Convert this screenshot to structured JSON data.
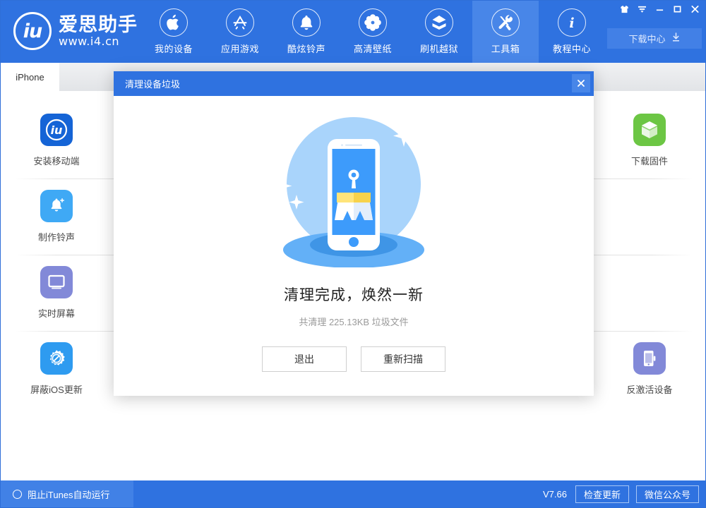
{
  "brand": {
    "logo_mark": "iu",
    "name_cn": "爱思助手",
    "url": "www.i4.cn"
  },
  "header": {
    "nav": [
      {
        "label": "我的设备",
        "icon": "apple-icon",
        "active": false
      },
      {
        "label": "应用游戏",
        "icon": "appstore-icon",
        "active": false
      },
      {
        "label": "酷炫铃声",
        "icon": "bell-icon",
        "active": false
      },
      {
        "label": "高清壁纸",
        "icon": "flower-icon",
        "active": false
      },
      {
        "label": "刷机越狱",
        "icon": "box-icon",
        "active": false
      },
      {
        "label": "工具箱",
        "icon": "tools-icon",
        "active": true
      },
      {
        "label": "教程中心",
        "icon": "info-icon",
        "active": false
      }
    ],
    "window_controls": [
      {
        "name": "skin-icon",
        "glyph": "shirt"
      },
      {
        "name": "menu-icon",
        "glyph": "caret"
      },
      {
        "name": "minimize-icon",
        "glyph": "minimize"
      },
      {
        "name": "maximize-icon",
        "glyph": "maximize"
      },
      {
        "name": "close-icon",
        "glyph": "close"
      }
    ],
    "download_center": {
      "label": "下载中心",
      "icon": "download-icon"
    }
  },
  "tabs": [
    {
      "label": "iPhone",
      "active": true
    }
  ],
  "toolbox": {
    "rows": [
      [
        {
          "label": "安装移动端",
          "icon": "i4-app-icon",
          "color": "#1564d6"
        },
        {
          "label": "下载固件",
          "icon": "cube-icon",
          "color": "#6cc644"
        }
      ],
      [
        {
          "label": "制作铃声",
          "icon": "ringtone-icon",
          "color": "#3fa9f5"
        }
      ],
      [
        {
          "label": "实时屏幕",
          "icon": "screen-icon",
          "color": "#8289d8"
        }
      ],
      [
        {
          "label": "屏蔽iOS更新",
          "icon": "block-update-icon",
          "color": "#2e9bf0"
        },
        {
          "label": "反激活设备",
          "icon": "deactivate-icon",
          "color": "#8289d8"
        }
      ]
    ],
    "items": [
      {
        "label": "安装移动端",
        "icon": "i4-app-icon",
        "col": 0,
        "row": 0
      },
      {
        "label": "下载固件",
        "icon": "cube-icon",
        "col": 6,
        "row": 0
      },
      {
        "label": "制作铃声",
        "icon": "ringtone-icon",
        "col": 0,
        "row": 1
      },
      {
        "label": "实时屏幕",
        "icon": "screen-icon",
        "col": 0,
        "row": 2
      },
      {
        "label": "屏蔽iOS更新",
        "icon": "block-update-icon",
        "col": 0,
        "row": 3
      },
      {
        "label": "反激活设备",
        "icon": "deactivate-icon",
        "col": 6,
        "row": 3
      }
    ]
  },
  "modal": {
    "title": "清理设备垃圾",
    "close_label": "×",
    "illustration": "phone-broom-illustration",
    "headline": "清理完成，焕然一新",
    "subtext": "共清理 225.13KB 垃圾文件",
    "buttons": [
      {
        "label": "退出",
        "name": "exit-button"
      },
      {
        "label": "重新扫描",
        "name": "rescan-button"
      }
    ]
  },
  "statusbar": {
    "itunes_toggle_label": "阻止iTunes自动运行",
    "version": "V7.66",
    "check_update_label": "检查更新",
    "wechat_label": "微信公众号"
  },
  "colors": {
    "brand_blue": "#2f72e0",
    "active_blue": "#4886e8",
    "illus_light": "#a9d4fb",
    "illus_mid": "#3d9bfb"
  }
}
